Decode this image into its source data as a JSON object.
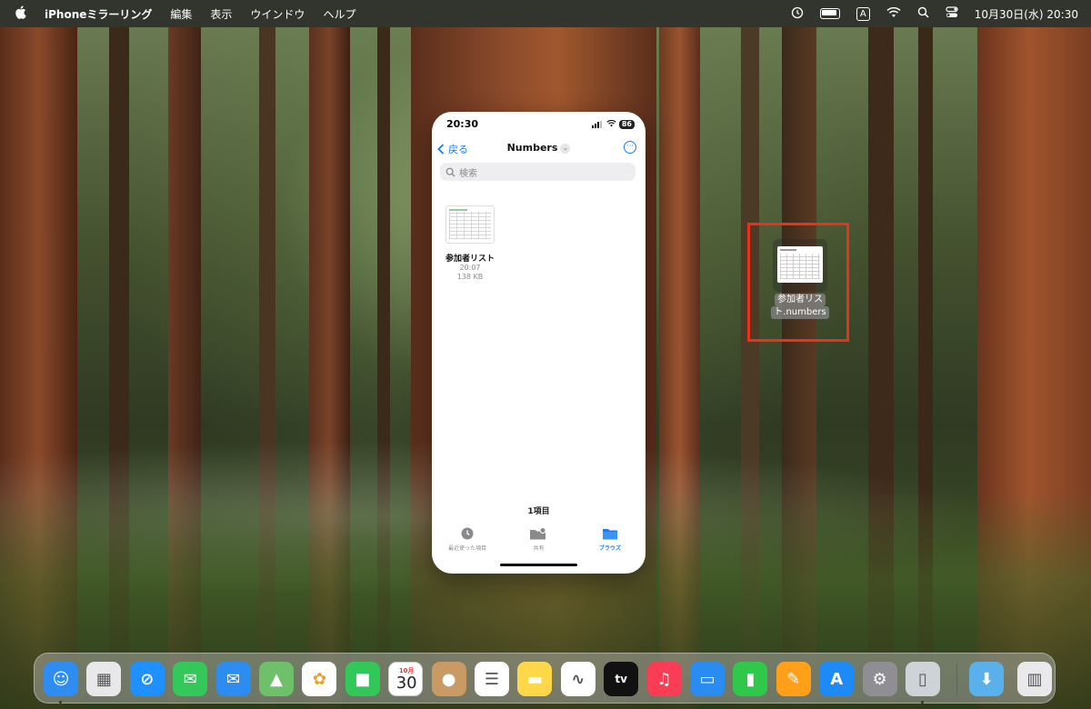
{
  "menubar": {
    "apple_icon": "apple-icon",
    "app_name": "iPhoneミラーリング",
    "items": [
      "編集",
      "表示",
      "ウインドウ",
      "ヘルプ"
    ],
    "input_mode": "A",
    "datetime": "10月30日(水)  20:30"
  },
  "phone": {
    "status_time": "20:30",
    "battery": "86",
    "back_label": "戻る",
    "title": "Numbers",
    "search_placeholder": "検索",
    "file": {
      "name": "参加者リスト",
      "time": "20:07",
      "size": "138 KB"
    },
    "item_count": "1項目",
    "tabs": [
      {
        "label": "最近使った項目",
        "icon": "clock-icon",
        "active": false
      },
      {
        "label": "共有",
        "icon": "shared-folder-icon",
        "active": false
      },
      {
        "label": "ブラウズ",
        "icon": "folder-icon",
        "active": true
      }
    ],
    "accent": "#1a7cf5"
  },
  "desktop_file": {
    "label_line1": "参加者リス",
    "label_line2": "ト.numbers",
    "highlight_color": "#e8321c"
  },
  "dock": {
    "apps": [
      {
        "name": "Finder",
        "icon": "finder-icon",
        "color": "#2f8cf0"
      },
      {
        "name": "Launchpad",
        "icon": "launchpad-icon",
        "color": "#e8e8ea"
      },
      {
        "name": "Safari",
        "icon": "safari-icon",
        "color": "#1e90ff"
      },
      {
        "name": "Messages",
        "icon": "messages-icon",
        "color": "#34c759"
      },
      {
        "name": "Mail",
        "icon": "mail-icon",
        "color": "#2d8cf0"
      },
      {
        "name": "Maps",
        "icon": "maps-icon",
        "color": "#6fc06a"
      },
      {
        "name": "Photos",
        "icon": "photos-icon",
        "color": "#ffffff"
      },
      {
        "name": "FaceTime",
        "icon": "facetime-icon",
        "color": "#32c759"
      },
      {
        "name": "Calendar",
        "icon": "calendar-icon",
        "color": "#ffffff",
        "month": "10月",
        "day": "30"
      },
      {
        "name": "Contacts",
        "icon": "contacts-icon",
        "color": "#c99a63"
      },
      {
        "name": "Reminders",
        "icon": "reminders-icon",
        "color": "#ffffff"
      },
      {
        "name": "Notes",
        "icon": "notes-icon",
        "color": "#ffd84a"
      },
      {
        "name": "Freeform",
        "icon": "freeform-icon",
        "color": "#ffffff"
      },
      {
        "name": "TV",
        "icon": "tv-icon",
        "color": "#111111",
        "text": "tv"
      },
      {
        "name": "Music",
        "icon": "music-icon",
        "color": "#fa3c55"
      },
      {
        "name": "Keynote",
        "icon": "keynote-icon",
        "color": "#2a8cf0"
      },
      {
        "name": "Numbers",
        "icon": "numbers-icon",
        "color": "#2fc84a"
      },
      {
        "name": "Pages",
        "icon": "pages-icon",
        "color": "#ff9f1a"
      },
      {
        "name": "App Store",
        "icon": "appstore-icon",
        "color": "#1e8af5"
      },
      {
        "name": "System Settings",
        "icon": "settings-icon",
        "color": "#8e8e93"
      },
      {
        "name": "iPhone Mirroring",
        "icon": "iphone-mirroring-icon",
        "color": "#cfd2d6"
      },
      {
        "name": "Downloads",
        "icon": "downloads-icon",
        "color": "#5ab0ea"
      },
      {
        "name": "Trash",
        "icon": "trash-icon",
        "color": "#e9e9ec"
      }
    ]
  }
}
